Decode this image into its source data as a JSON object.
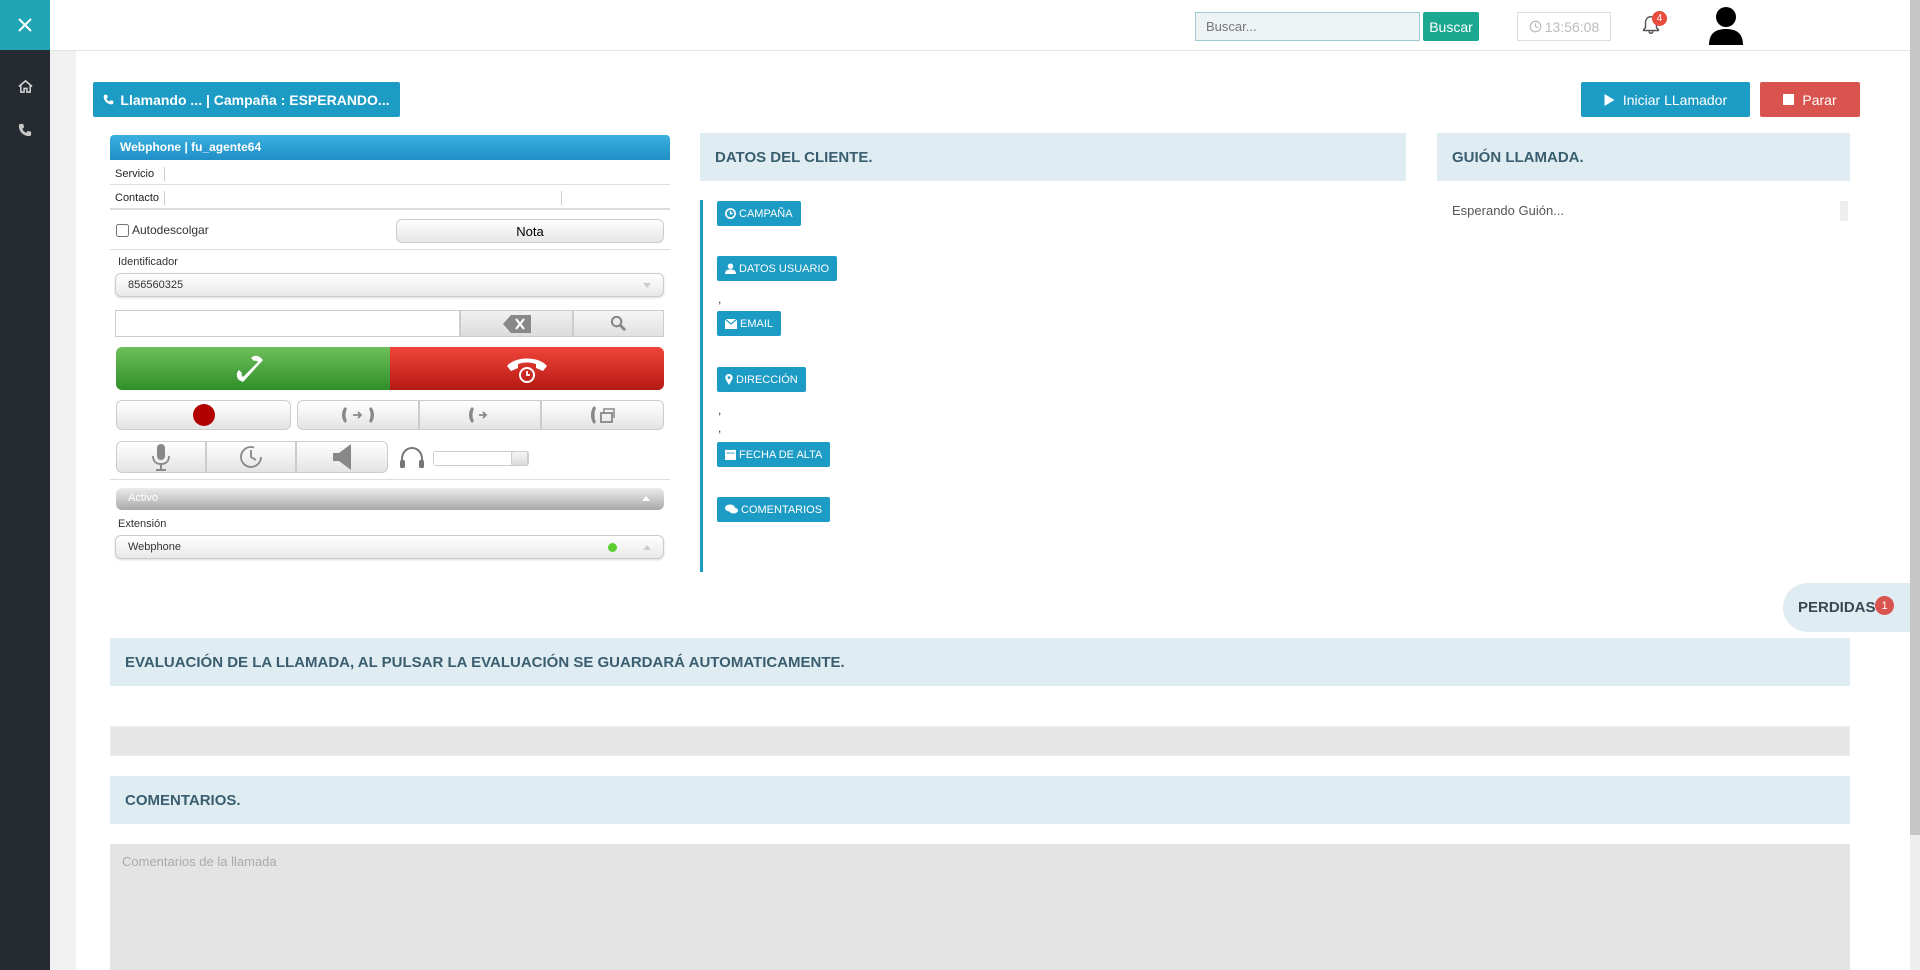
{
  "topbar": {
    "search_placeholder": "Buscar...",
    "search_button": "Buscar",
    "clock": "13:56:08",
    "notification_count": "4"
  },
  "toolbar": {
    "status_label": "Llamando ... | Campaña : ESPERANDO...",
    "start_caller_label": "Iniciar LLamador",
    "stop_label": "Parar"
  },
  "webphone": {
    "title": "Webphone | fu_agente64",
    "servicio_label": "Servicio",
    "contacto_label": "Contacto",
    "autodescolgar_label": "Autodescolgar",
    "nota_label": "Nota",
    "identificador_label": "Identificador",
    "identificador_value": "856560325",
    "status_value": "Activo",
    "extension_label": "Extensión",
    "extension_value": "Webphone",
    "volume_level": 0.82
  },
  "cliente": {
    "title": "DATOS DEL CLIENTE.",
    "campana": "CAMPAÑA",
    "datos_usuario": "DATOS USUARIO",
    "email": "EMAIL",
    "direccion": "DIRECCIÓN",
    "fecha_alta": "FECHA DE ALTA",
    "comentarios": "COMENTARIOS",
    "comma": ","
  },
  "guion": {
    "title": "GUIÓN LLAMADA.",
    "text": "Esperando Guión..."
  },
  "perdidas": {
    "label": "PERDIDAS",
    "count": "1"
  },
  "evaluacion": {
    "title": "EVALUACIÓN DE LA LLAMADA, AL PULSAR LA EVALUACIÓN SE GUARDARÁ AUTOMATICAMENTE."
  },
  "comentarios": {
    "title": "COMENTARIOS.",
    "placeholder": "Comentarios de la llamada"
  },
  "colors": {
    "accent": "#1c9bc4",
    "sidebar": "#262b31",
    "sidebar_toggle": "#1fa5b3",
    "danger": "#d9534f",
    "success": "#1ba890"
  }
}
